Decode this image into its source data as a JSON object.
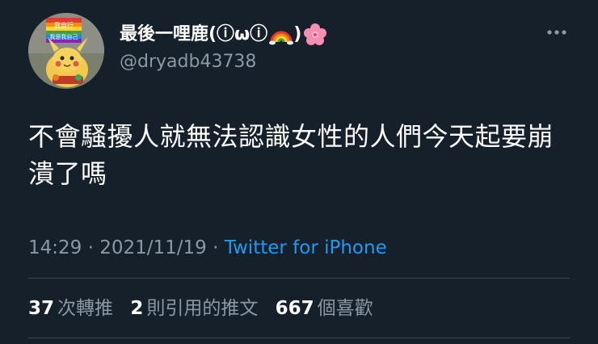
{
  "user": {
    "display_name": "最後一哩鹿(ⓘωⓘ",
    "display_name_close": ")",
    "handle": "@dryadb43738",
    "avatar_badge_line1": "我自行",
    "avatar_badge_line2": "我是我自己"
  },
  "tweet": {
    "text": "不會騷擾人就無法認識女性的人們今天起要崩潰了嗎",
    "time": "14:29",
    "separator": "·",
    "date": "2021/11/19",
    "source": "Twitter for iPhone"
  },
  "stats": {
    "retweets_count": "37",
    "retweets_label": "次轉推",
    "quotes_count": "2",
    "quotes_label": "則引用的推文",
    "likes_count": "667",
    "likes_label": "個喜歡"
  },
  "colors": {
    "background": "#15202b",
    "text": "#ffffff",
    "secondary": "#8b98a5",
    "link": "#1d9bf0",
    "divider": "#38444d"
  },
  "icons": {
    "more": "more-horizontal-icon",
    "rainbow": "rainbow-emoji",
    "flower": "cherry-blossom-emoji"
  }
}
